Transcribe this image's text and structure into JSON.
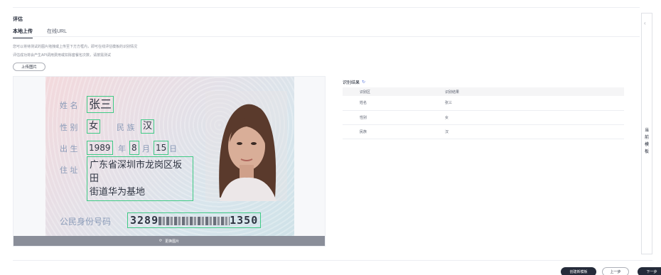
{
  "section_title": "评估",
  "tabs": [
    {
      "label": "本地上传",
      "active": true
    },
    {
      "label": "在线URL",
      "active": false
    }
  ],
  "hints": {
    "line1": "您可以将待测试的图片拖拽或上传至下方方框内，即可在线评估模板的识别情况",
    "line2": "评估成功将会产生API调用费用或扣除套餐包次数，请按需测试"
  },
  "upload_button": "上传图片",
  "id_card": {
    "name_label": "姓 名",
    "name_value": "张三",
    "gender_label": "性 别",
    "gender_value": "女",
    "ethnicity_label": "民 族",
    "ethnicity_value": "汉",
    "birth_label": "出 生",
    "birth_year": "1989",
    "year_label": "年",
    "birth_month": "8",
    "month_label": "月",
    "birth_day": "15",
    "day_label": "日",
    "address_label": "住 址",
    "address_line1": "广东省深圳市龙岗区坂田",
    "address_line2": "街道华为基地",
    "id_label": "公民身份号码",
    "id_prefix": "3289",
    "id_suffix": "1350"
  },
  "reupload_label": "更换图片",
  "results": {
    "title": "识别结果",
    "headers": [
      "识别区",
      "识别结果"
    ],
    "rows": [
      {
        "field": "姓名",
        "value": "张三"
      },
      {
        "field": "性别",
        "value": "女"
      },
      {
        "field": "民族",
        "value": "汉"
      }
    ]
  },
  "side_panel": {
    "label": "当前模板"
  },
  "footer": {
    "create_label": "创建新模板",
    "prev_label": "上一步",
    "next_label": "下一步"
  },
  "colors": {
    "primary": "#252b3a",
    "highlight_box": "#3fca85",
    "link": "#5e7ce0"
  }
}
